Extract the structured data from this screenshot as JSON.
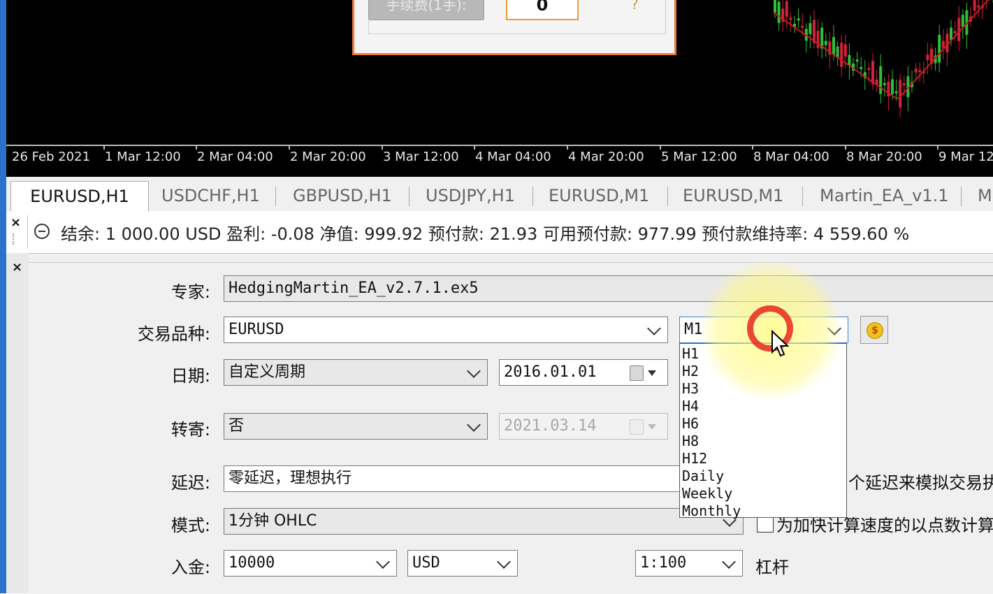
{
  "chart": {
    "time_labels": [
      "26 Feb 2021",
      "1 Mar 12:00",
      "2 Mar 04:00",
      "2 Mar 20:00",
      "3 Mar 12:00",
      "4 Mar 04:00",
      "4 Mar 20:00",
      "5 Mar 12:00",
      "8 Mar 04:00",
      "8 Mar 20:00",
      "9 Mar 12"
    ]
  },
  "popup": {
    "fee_label": "手续费(1手):",
    "fee_value": "0",
    "help": "?"
  },
  "tabs": [
    "EURUSD,H1",
    "USDCHF,H1",
    "GBPUSD,H1",
    "USDJPY,H1",
    "EURUSD,M1",
    "EURUSD,M1",
    "Martin_EA_v1.1",
    "M"
  ],
  "account": {
    "text": "结余: 1 000.00 USD  盈利: -0.08  净值: 999.92  预付款: 21.93  可用预付款: 977.99  预付款维持率: 4 559.60 %",
    "close": "×"
  },
  "tester": {
    "close": "×",
    "expert": {
      "label": "专家:",
      "value": "HedgingMartin_EA_v2.7.1.ex5"
    },
    "symbol": {
      "label": "交易品种:",
      "value": "EURUSD"
    },
    "timeframe": {
      "value": "M1",
      "options": [
        "H1",
        "H2",
        "H3",
        "H4",
        "H6",
        "H8",
        "H12",
        "Daily",
        "Weekly",
        "Monthly"
      ]
    },
    "date": {
      "label": "日期:",
      "period": "自定义周期",
      "from": "2016.01.01"
    },
    "forward": {
      "label": "转寄:",
      "value": "否",
      "date": "2021.03.14"
    },
    "delay": {
      "label": "延迟:",
      "value": "零延迟，理想执行",
      "trail": "个延迟来模拟交易执"
    },
    "mode": {
      "label": "模式:",
      "value": "1分钟 OHLC",
      "trail": "为加快计算速度的以点数计算"
    },
    "deposit": {
      "label": "入金:",
      "amount": "10000",
      "currency": "USD",
      "leverage": "1:100",
      "leverage_label": "杠杆"
    }
  },
  "colors": {
    "bull": "#2fbf3a",
    "bear": "#d4203a",
    "ma": "#c41f1f",
    "accent": "#f07a3a"
  }
}
